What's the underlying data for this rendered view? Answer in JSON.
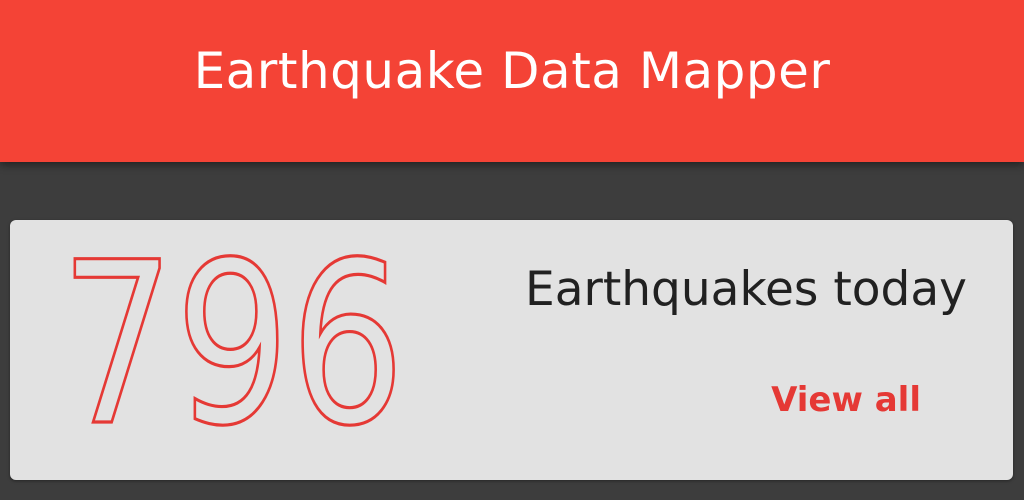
{
  "app_bar": {
    "title": "Earthquake Data Mapper",
    "color": "#f44336"
  },
  "summary_card": {
    "count": "796",
    "label": "Earthquakes today",
    "view_all_label": "View all",
    "accent_color": "#e53935"
  }
}
